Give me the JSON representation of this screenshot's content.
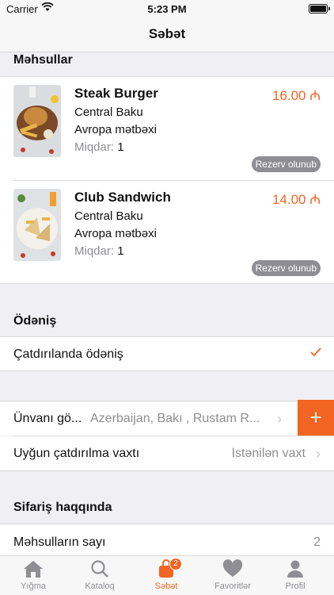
{
  "status_bar": {
    "carrier": "Carrier",
    "time": "5:23 PM"
  },
  "nav": {
    "title": "Səbət"
  },
  "products_section": {
    "title": "Məhsullar",
    "items": [
      {
        "name": "Steak Burger",
        "restaurant": "Central Baku",
        "cuisine": "Avropa mətbəxi",
        "qty_label": "Miqdar:",
        "qty": "1",
        "price": "16.00 ₼",
        "badge": "Rezerv olunub"
      },
      {
        "name": "Club Sandwich",
        "restaurant": "Central Baku",
        "cuisine": "Avropa mətbəxi",
        "qty_label": "Miqdar:",
        "qty": "1",
        "price": "14.00 ₼",
        "badge": "Rezerv olunub"
      }
    ]
  },
  "payment_section": {
    "title": "Ödəniş",
    "option": "Çatdırılanda ödəniş"
  },
  "delivery": {
    "address_label": "Ünvanı gö...",
    "address_value": "Azerbaijan, Bakı , Rustam R...",
    "time_label": "Uyğun çatdırılma vaxtı",
    "time_value": "İstənilən vaxt"
  },
  "order_section": {
    "title": "Sifariş haqqında",
    "count_label": "Məhsulların sayı",
    "count_value": "2"
  },
  "tabbar": {
    "items": [
      {
        "label": "Yığma",
        "icon": "home-icon"
      },
      {
        "label": "Kataloq",
        "icon": "search-icon"
      },
      {
        "label": "Səbət",
        "icon": "bag-icon",
        "badge": "2"
      },
      {
        "label": "Favoritlər",
        "icon": "heart-icon"
      },
      {
        "label": "Profil",
        "icon": "person-icon"
      }
    ]
  },
  "colors": {
    "accent": "#f26522",
    "gray": "#8e8e93",
    "background": "#efeff4"
  }
}
